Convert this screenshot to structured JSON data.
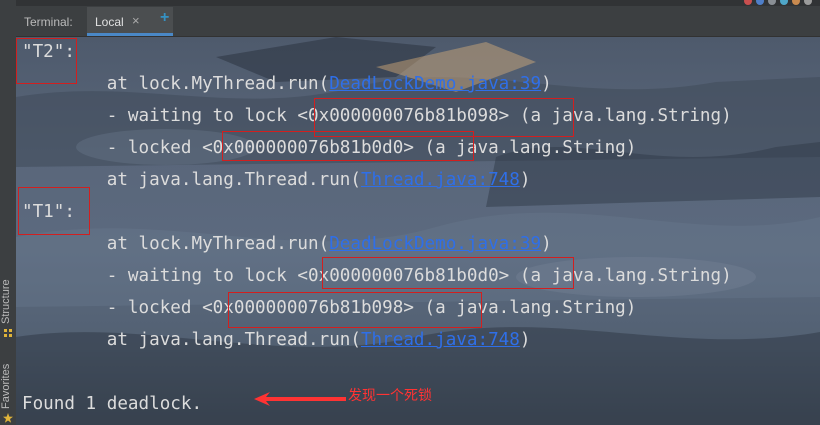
{
  "header": {
    "title": "Terminal:",
    "tab_label": "Local",
    "close_symbol": "×",
    "add_symbol": "+"
  },
  "sidebar": {
    "structure_label": "Structure",
    "favorites_label": "Favorites"
  },
  "terminal": {
    "t2_header": "\"T2\":",
    "t2_run": {
      "prefix": "at lock.MyThread.run(",
      "link": "DeadLockDemo.java:39",
      "suffix": ")"
    },
    "t2_waiting": "- waiting to lock <0x000000076b81b098> (a java.lang.String)",
    "t2_locked": "- locked <0x000000076b81b0d0> (a java.lang.String)",
    "t2_thread": {
      "prefix": "at java.lang.Thread.run(",
      "link": "Thread.java:748",
      "suffix": ")"
    },
    "t1_header": "\"T1\":",
    "t1_run": {
      "prefix": "at lock.MyThread.run(",
      "link": "DeadLockDemo.java:39",
      "suffix": ")"
    },
    "t1_waiting": "- waiting to lock <0x000000076b81b0d0> (a java.lang.String)",
    "t1_locked": "- locked <0x000000076b81b098> (a java.lang.String)",
    "t1_thread": {
      "prefix": "at java.lang.Thread.run(",
      "link": "Thread.java:748",
      "suffix": ")"
    },
    "summary": "Found 1 deadlock."
  },
  "annotation": {
    "text": "发现一个死锁",
    "color": "#ff3333"
  },
  "colors": {
    "link": "#2f6fe8",
    "highlight_box": "#d21f1f",
    "tab_accent": "#4a88c7"
  }
}
